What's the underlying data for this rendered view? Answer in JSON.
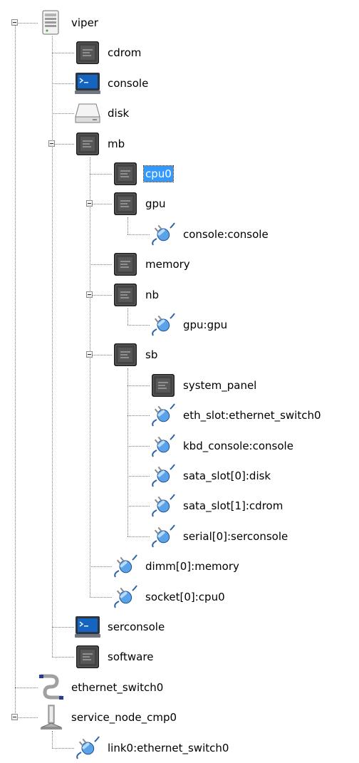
{
  "tree": {
    "nodes": [
      {
        "label": "viper",
        "icon": "server-icon",
        "depth": 0,
        "expanded": true
      },
      {
        "label": "cdrom",
        "icon": "chip-icon",
        "depth": 1
      },
      {
        "label": "console",
        "icon": "monitor-icon",
        "depth": 1
      },
      {
        "label": "disk",
        "icon": "disk-drive-icon",
        "depth": 1
      },
      {
        "label": "mb",
        "icon": "chip-icon",
        "depth": 1,
        "expanded": true
      },
      {
        "label": "cpu0",
        "icon": "chip-icon",
        "depth": 2,
        "selected": true
      },
      {
        "label": "gpu",
        "icon": "chip-icon",
        "depth": 2,
        "expanded": true
      },
      {
        "label": "console:console",
        "icon": "connector-icon",
        "depth": 3
      },
      {
        "label": "memory",
        "icon": "chip-icon",
        "depth": 2
      },
      {
        "label": "nb",
        "icon": "chip-icon",
        "depth": 2,
        "expanded": true
      },
      {
        "label": "gpu:gpu",
        "icon": "connector-icon",
        "depth": 3
      },
      {
        "label": "sb",
        "icon": "chip-icon",
        "depth": 2,
        "expanded": true
      },
      {
        "label": "system_panel",
        "icon": "chip-icon",
        "depth": 3
      },
      {
        "label": "eth_slot:ethernet_switch0",
        "icon": "connector-icon",
        "depth": 3
      },
      {
        "label": "kbd_console:console",
        "icon": "connector-icon",
        "depth": 3
      },
      {
        "label": "sata_slot[0]:disk",
        "icon": "connector-icon",
        "depth": 3
      },
      {
        "label": "sata_slot[1]:cdrom",
        "icon": "connector-icon",
        "depth": 3
      },
      {
        "label": "serial[0]:serconsole",
        "icon": "connector-icon",
        "depth": 3
      },
      {
        "label": "dimm[0]:memory",
        "icon": "connector-icon",
        "depth": 2
      },
      {
        "label": "socket[0]:cpu0",
        "icon": "connector-icon",
        "depth": 2
      },
      {
        "label": "serconsole",
        "icon": "monitor-icon",
        "depth": 1
      },
      {
        "label": "software",
        "icon": "chip-icon",
        "depth": 1
      },
      {
        "label": "ethernet_switch0",
        "icon": "cable-icon",
        "depth": 0
      },
      {
        "label": "service_node_cmp0",
        "icon": "service-node-icon",
        "depth": 0,
        "expanded": true
      },
      {
        "label": "link0:ethernet_switch0",
        "icon": "connector-icon",
        "depth": 1
      }
    ]
  }
}
